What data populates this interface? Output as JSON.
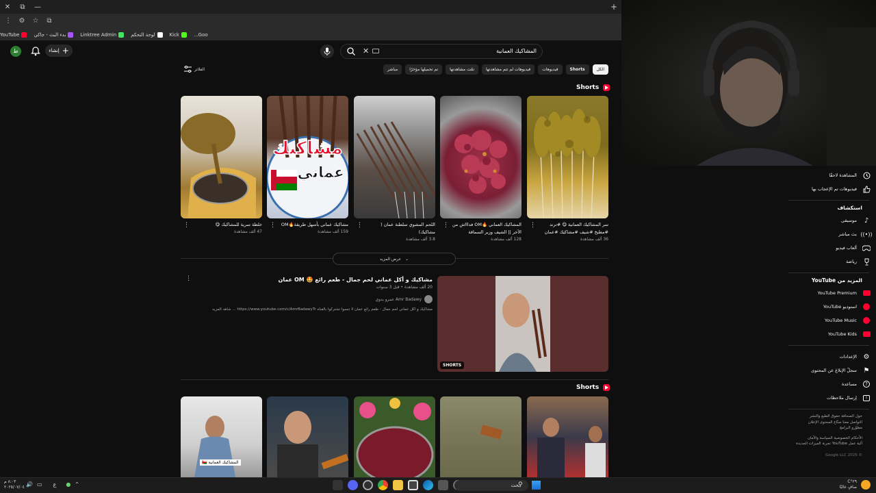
{
  "browser": {
    "window_controls": [
      "✕",
      "⧉",
      "—"
    ],
    "new_tab": "+",
    "bookmarks": [
      {
        "label": "Goo...",
        "color": "#888888"
      },
      {
        "label": "Kick",
        "color": "#53fc18"
      },
      {
        "label": "لوحة التحكم",
        "color": "#ffffff"
      },
      {
        "label": "Linktree Admin",
        "color": "#43e55e"
      },
      {
        "label": "بدء البث - جاكي",
        "color": "#a855f7"
      },
      {
        "label": "YouTube",
        "color": "#ff0033"
      }
    ]
  },
  "youtube": {
    "avatar_letter": "ط",
    "create_label": "إنشاء",
    "search_query": "المشاكيك العمانية",
    "filter_label": "الفلاتر",
    "chips": [
      {
        "label": "الكل",
        "active": true
      },
      {
        "label": "Shorts",
        "active": false
      },
      {
        "label": "فيديوهات",
        "active": false
      },
      {
        "label": "فيديوهات لم تتم مشاهدتها",
        "active": false
      },
      {
        "label": "تمّت مشاهدتها",
        "active": false
      },
      {
        "label": "تم تحميلها مؤخرًا",
        "active": false
      },
      {
        "label": "مباشر",
        "active": false
      }
    ],
    "shorts_section_title": "Shorts",
    "shorts_row1": [
      {
        "title": "سر المشاكيك العمانية 😋 #ترند #مطبخ #شيف #مشاكيك #عمان #لحم",
        "views": "36 ألف مشاهدة"
      },
      {
        "title": "المشاكيك العماني 🔥OM فداااش من الآخر || الشيف وزير السماقة",
        "views": "128 ألف مشاهدة"
      },
      {
        "title": "اللحم المشوي سلطنة عمان ( مشاكيك)",
        "views": "3.8 ألف مشاهدة"
      },
      {
        "title": "مشاكيك عماني بأسهل طريقة🔥OM",
        "views": "159 ألف مشاهدة"
      },
      {
        "title": "خلطة سرية للمشاكيك 😋",
        "views": "47 ألف مشاهدة"
      }
    ],
    "show_more_label": "عرض المزيد",
    "video": {
      "title": "مشاكيك و أكل عماني لحم جمال - طعم رائع 🤩 OM عمان",
      "meta": "20 ألف مشاهدة • قبل 3 سنوات",
      "channel": "Amr Badawy  عمرو بدوي",
      "description": "مشاكيك و أكل عماني لحم جمال - طعم رائع عمان لا تنسوا تشتركوا بالقناه https://www.youtube.com/c/AmrBadawyTr ... شاهد المزيد",
      "badge": "SHORTS"
    },
    "shorts_section2_title": "Shorts",
    "thumb2_text": "المشاكيك العمانية 🇴🇲",
    "thumb_overlay_main": "مشاكيك",
    "thumb_overlay_sub": "عماني"
  },
  "sidebar": {
    "top_items": [
      {
        "label": "المشاهدة لاحقًا",
        "icon": "clock-icon"
      },
      {
        "label": "فيديوهات تم الإعجاب بها",
        "icon": "thumbs-up-icon"
      }
    ],
    "explore_title": "استكشاف",
    "explore_items": [
      {
        "label": "موسيقى",
        "icon": "music-icon"
      },
      {
        "label": "بث مباشر",
        "icon": "live-icon"
      },
      {
        "label": "ألعاب فيديو",
        "icon": "gamepad-icon"
      },
      {
        "label": "رياضة",
        "icon": "trophy-icon"
      }
    ],
    "more_title": "المزيد من YouTube",
    "more_items": [
      {
        "label": "YouTube Premium",
        "icon": "yt-premium-icon"
      },
      {
        "label": "استوديو YouTube",
        "icon": "yt-studio-icon"
      },
      {
        "label": "YouTube Music",
        "icon": "yt-music-icon"
      },
      {
        "label": "YouTube Kids",
        "icon": "yt-kids-icon"
      }
    ],
    "settings_items": [
      {
        "label": "الإعدادات",
        "icon": "gear-icon"
      },
      {
        "label": "سجلّ الإبلاغ عن المحتوى",
        "icon": "flag-icon"
      },
      {
        "label": "مساعدة",
        "icon": "help-icon"
      },
      {
        "label": "إرسال ملاحظات",
        "icon": "feedback-icon"
      }
    ],
    "footer_lines": [
      "حول  الصحافة  حقوق الطبع والنشر",
      "التواصل معنا  صنّاع المحتوى  الإعلان",
      "مطوّرو البرامج",
      "الأحكام  الخصوصية  السياسة والأمان",
      "آلية عمل YouTube  تجربة الميزات الجديدة",
      "© 2025 Google LLC"
    ]
  },
  "taskbar": {
    "time": "٨:٠٣ م",
    "date": "٢٠٢٥/٠٧/٠٤",
    "lang": "ع",
    "search_placeholder": "بحث",
    "weather_temp": "٢٩°C",
    "weather_desc": "صافٍ غالبًا"
  }
}
